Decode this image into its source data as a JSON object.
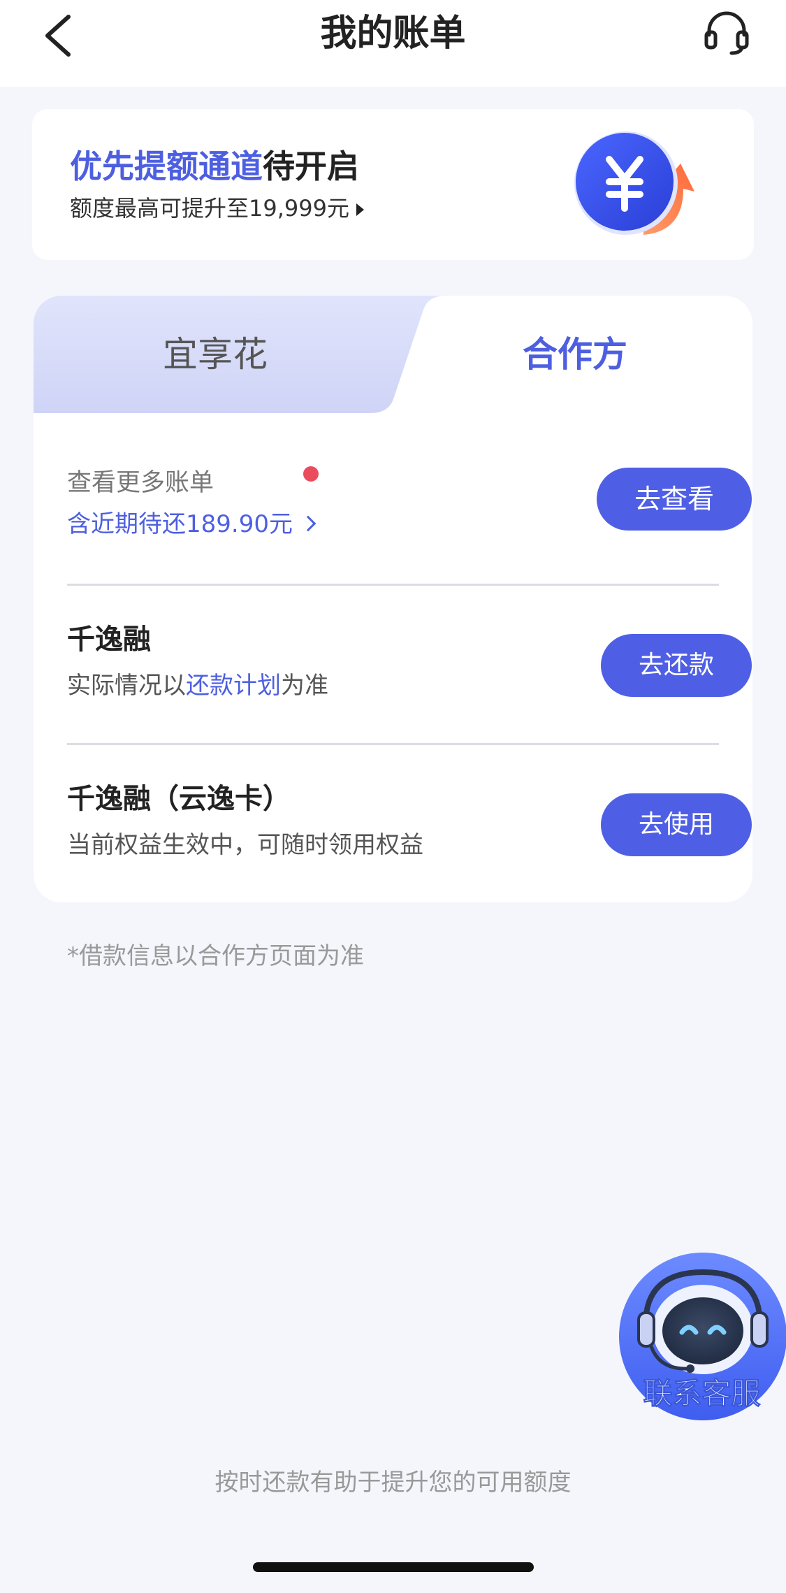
{
  "header": {
    "title": "我的账单",
    "back_icon": "chevron-left-icon",
    "service_icon": "headset-icon"
  },
  "promo": {
    "title_highlight": "优先提额通道",
    "title_rest": "待开启",
    "subtitle": "额度最高可提升至19,999元",
    "icon": "yuan-upgrade-icon"
  },
  "tabs": [
    {
      "label": "宜享花",
      "active": false
    },
    {
      "label": "合作方",
      "active": true
    }
  ],
  "bills": {
    "more": {
      "title": "查看更多账单",
      "subtitle": "含近期待还189.90元",
      "button": "去查看"
    },
    "items": [
      {
        "name": "千逸融",
        "desc_prefix": "实际情况以",
        "desc_link": "还款计划",
        "desc_suffix": "为准",
        "button": "去还款"
      },
      {
        "name": "千逸融（云逸卡）",
        "desc": "当前权益生效中，可随时领用权益",
        "button": "去使用"
      }
    ]
  },
  "footnote": "*借款信息以合作方页面为准",
  "float_service": {
    "label": "联系客服",
    "icon": "robot-headset-icon"
  },
  "bottom_tip": "按时还款有助于提升您的可用额度",
  "colors": {
    "accent": "#4d5fe0",
    "button": "#4f5fe5",
    "background": "#f5f6fc",
    "red_dot": "#ea4c5e"
  }
}
